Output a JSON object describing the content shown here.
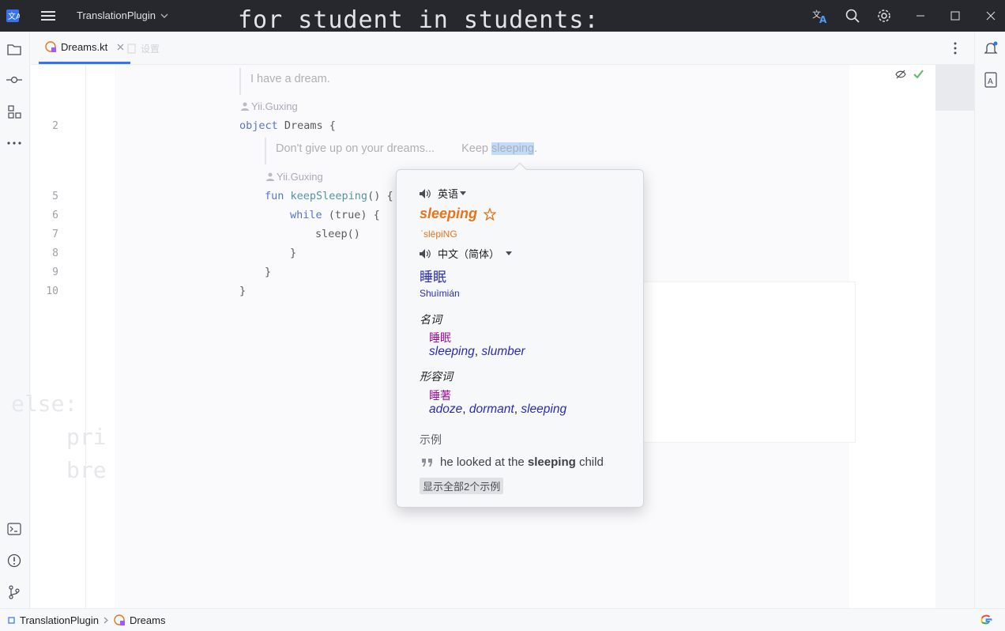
{
  "titlebar": {
    "project_name": "TranslationPlugin",
    "icons": [
      "app-logo-icon",
      "hamburger-menu-icon",
      "chevron-down-icon",
      "translate-icon",
      "search-icon",
      "settings-icon",
      "minimize-icon",
      "maximize-icon",
      "close-icon"
    ]
  },
  "tabs": {
    "active_label": "Dreams.kt",
    "inactive_label": "设置"
  },
  "editor": {
    "doc_line1": "I have a dream.",
    "author": "Yii.Guxing",
    "author2": "Yii.Guxing",
    "doc_line2_part1": "Don't give up on your dreams...",
    "doc_line2_part2": "Keep ",
    "doc_line2_selected": "sleeping",
    "doc_line2_part3": ".",
    "line_numbers": [
      "2",
      "5",
      "6",
      "7",
      "8",
      "9",
      "10"
    ],
    "code": {
      "l1_kw": "object",
      "l1_rest": " Dreams {",
      "l2_kw": "fun",
      "l2_fn": "keepSleeping",
      "l2_rest": "() {",
      "l3_kw": "while",
      "l3_rest": " (true) {",
      "l4": "sleep()",
      "l5": "}",
      "l6": "}",
      "l7": "}"
    }
  },
  "ghost": {
    "code_top": "for student in students:",
    "code_left_1": "else:",
    "code_left_2": "pri",
    "code_left_3": "bre"
  },
  "popup": {
    "source_lang": "英语",
    "word": "sleeping",
    "phonetic": "ˈslēpiNG",
    "target_lang": "中文（简体）",
    "translation": "睡眠",
    "pinyin": "Shuìmián",
    "pos1": "名词",
    "pos1_zh": "睡眠",
    "pos1_syn1": "sleeping",
    "pos1_syn2": "slumber",
    "pos2": "形容词",
    "pos2_zh": "睡著",
    "pos2_syn1": "adoze",
    "pos2_syn2": "dormant",
    "pos2_syn3": "sleeping",
    "examples_label": "示例",
    "example_pre": "he looked at the ",
    "example_bold": "sleeping",
    "example_post": " child",
    "show_all": "显示全部2个示例"
  },
  "statusbar": {
    "crumb1": "TranslationPlugin",
    "crumb2": "Dreams"
  },
  "colors": {
    "accent": "#3574f0",
    "word": "#e8731a",
    "translation": "#2a2ab8",
    "purple": "#a0129a"
  }
}
